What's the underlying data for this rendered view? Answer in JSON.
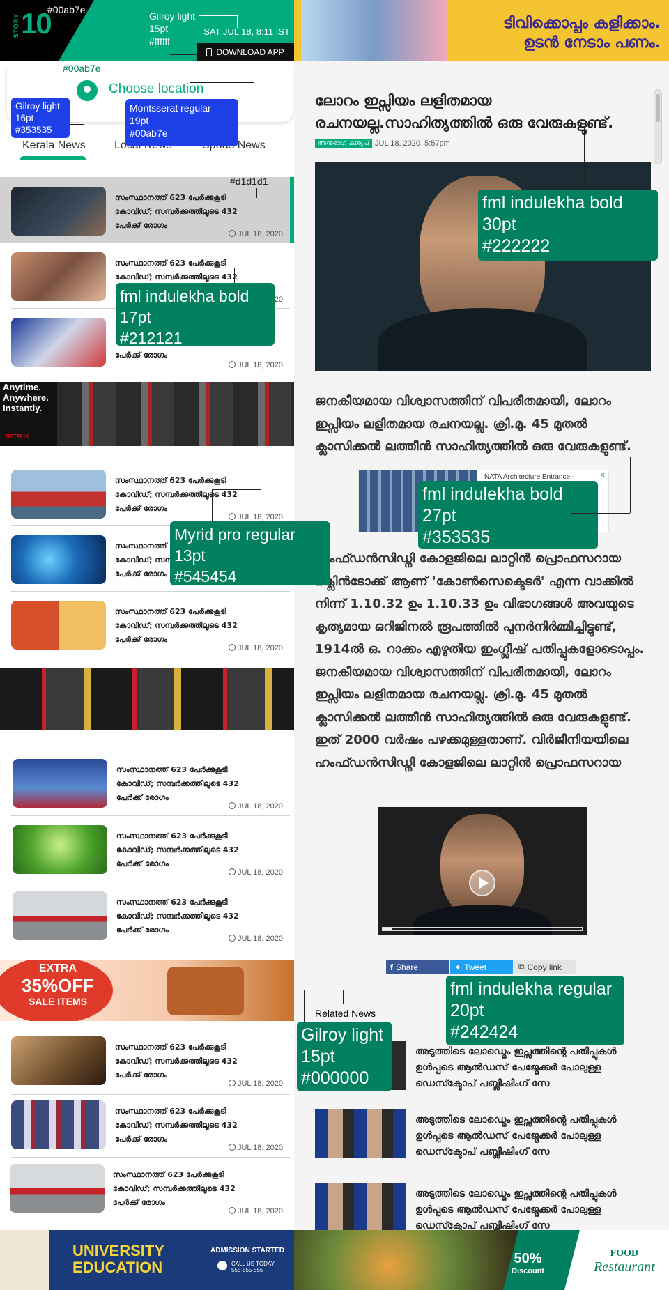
{
  "left": {
    "logo_side": "STORY",
    "logo_main": "10",
    "datetime": "SAT JUL 18, 8:11 IST",
    "download": "DOWNLOAD APP",
    "choose_location": "Choose location",
    "tabs": [
      "Kerala News",
      "Local News",
      "Sports News"
    ],
    "news": [
      {
        "title": "സംസ്ഥാനത്ത് 623 പേർക്കുകൂടി കോവിഡ്; സമ്പർക്കത്തിലൂടെ 432 പേർക്ക് രോഗം",
        "date": "JUL 18, 2020"
      },
      {
        "title": "സംസ്ഥാനത്ത് 623 പേർക്കുകൂടി കോവിഡ്; സമ്പർക്കത്തിലൂടെ 432 പേർക്ക് രോഗം",
        "date": "JUL 18, 2020"
      },
      {
        "title": "പേർക്ക് രോഗം",
        "date": "JUL 18, 2020"
      },
      {
        "title": "സംസ്ഥാനത്ത് 623 പേർക്കുകൂടി കോവിഡ്; സമ്പർക്കത്തിലൂടെ 432 പേർക്ക് രോഗം",
        "date": "JUL 18, 2020"
      },
      {
        "title": "സംസ്ഥാനത്ത് 623 പേർക്കുകൂടി കോവിഡ്; സമ്പർക്കത്തിലൂടെ 432 പേർക്ക് രോഗം",
        "date": "JUL 18, 2020"
      },
      {
        "title": "സംസ്ഥാനത്ത് 623 പേർക്കുകൂടി കോവിഡ്; സമ്പർക്കത്തിലൂടെ 432 പേർക്ക് രോഗം",
        "date": "JUL 18, 2020"
      },
      {
        "title": "സംസ്ഥാനത്ത് 623 പേർക്കുകൂടി കോവിഡ്; സമ്പർക്കത്തിലൂടെ 432 പേർക്ക് രോഗം",
        "date": "JUL 18, 2020"
      },
      {
        "title": "സംസ്ഥാനത്ത് 623 പേർക്കുകൂടി കോവിഡ്; സമ്പർക്കത്തിലൂടെ 432 പേർക്ക് രോഗം",
        "date": "JUL 18, 2020"
      },
      {
        "title": "സംസ്ഥാനത്ത് 623 പേർക്കുകൂടി കോവിഡ്; സമ്പർക്കത്തിലൂടെ 432 പേർക്ക് രോഗം",
        "date": "JUL 18, 2020"
      },
      {
        "title": "സംസ്ഥാനത്ത് 623 പേർക്കുകൂടി കോവിഡ്; സമ്പർക്കത്തിലൂടെ 432 പേർക്ക് രോഗം",
        "date": "JUL 18, 2020"
      },
      {
        "title": "സംസ്ഥാനത്ത് 623 പേർക്കുകൂടി കോവിഡ്; സമ്പർക്കത്തിലൂടെ 432 പേർക്ക് രോഗം",
        "date": "JUL 18, 2020"
      },
      {
        "title": "സംസ്ഥാനത്ത് 623 പേർക്കുകൂടി കോവിഡ്; സമ്പർക്കത്തിലൂടെ 432 പേർക്ക് രോഗം",
        "date": "JUL 18, 2020"
      }
    ],
    "ad_netflix": [
      "Anytime.",
      "Anywhere.",
      "Instantly.",
      "NETFLIX"
    ],
    "ad_sale": [
      "EXTRA",
      "35%OFF",
      "SALE ITEMS"
    ],
    "ad_university": [
      "UNIVERSITY",
      "EDUCATION",
      "ADMISSION STARTED",
      "CALL US TODAY",
      "555-555-555"
    ]
  },
  "right": {
    "banner": [
      "ടിവിക്കൊപ്പം കളിക്കാം.",
      "ഉടൻ നേടാം പണം."
    ],
    "title": "ലോറം ഇപ്സിയം ലളിതമായ രചനയല്ല.സാഹിത്യത്തിൽ ഒരു വേരുകളുണ്ട്.",
    "author": "അനുരാഗ് കശ്യപ്",
    "date": "JUL 18, 2020",
    "time": "5:57pm",
    "para1": "ജനകീയമായ വിശ്വാസത്തിന് വിപരീതമായി, ലോറം ഇപ്സിയം ലളിതമായ രചനയല്ല. ക്രി.മു. 45 മുതൽ ക്ലാസിക്കൽ ലത്തീൻ സാഹിത്യത്തിൽ ഒരു വേരുകളുണ്ട്.",
    "inline_ad": "NATA Architecture Entrance -",
    "para2": "ഹംഫ്ഡൻസിഡ്നി കോളജിലെ ലാറ്റിൻ പ്രൊഫസറായ മക്ലിൻടോക്ക് ആണ് 'കോൺസെക്ടെടർ' എന്ന വാക്കിൽ നിന്ന് 1.10.32 ഉം 1.10.33 ഉം വിഭാഗങ്ങൾ അവയുടെ കൃത്യമായ ഒറിജിനൽ രൂപത്തിൽ പുനർനിർമ്മിച്ചിട്ടുണ്ട്, 1914ൽ ഒ. റാക്കം എഴുതിയ ഇംഗ്ലീഷ് പതിപ്പുകളോടൊപ്പം. ജനകീയമായ വിശ്വാസത്തിന് വിപരീതമായി, ലോറം ഇപ്സിയം ലളിതമായ രചനയല്ല. ക്രി.മു. 45 മുതൽ ക്ലാസിക്കൽ ലത്തീൻ സാഹിത്യത്തിൽ ഒരു വേരുകളുണ്ട്. ഇത് 2000 വർഷം പഴക്കമുള്ളതാണ്. വിർജീനിയയിലെ ഹംഫ്ഡൻസിഡ്നി കോളജിലെ ലാറ്റിൻ പ്രൊഫസറായ",
    "share": [
      "Share",
      "Tweet",
      "Copy link"
    ],
    "related_heading": "Related News",
    "related": [
      "അടുത്തിടെ ലോഡ്മെം ഇപ്സത്തിന്റെ പതിപ്പുകൾ ഉൾപ്പടെ ആൽഡസ് പേജ്മേക്കർ പോലുള്ള ഡെസ്ക്ടോപ് പബ്ലിഷിംഗ് സേ",
      "അടുത്തിടെ ലോഡ്മെം ഇപ്സത്തിന്റെ പതിപ്പുകൾ ഉൾപ്പടെ ആൽഡസ് പേജ്മേക്കർ പോലുള്ള ഡെസ്ക്ടോപ് പബ്ലിഷിംഗ് സേ",
      "അടുത്തിടെ ലോഡ്മെം ഇപ്സത്തിന്റെ പതിപ്പുകൾ ഉൾപ്പടെ ആൽഡസ് പേജ്മേക്കർ പോലുള്ള ഡെസ്ക്ടോപ് പബ്ലിഷിംഗ് സേ"
    ],
    "ad_food": [
      "50%",
      "Discount",
      "FOOD",
      "Restaurant"
    ]
  },
  "annotations": {
    "a_00ab7e_top": "#00ab7e",
    "a_00ab7e_bottom": "#00ab7e",
    "a_gilroy_header": [
      "Gilroy light",
      "15pt",
      "#ffffff"
    ],
    "a_gilroy_tabs": [
      "Gilroy light",
      "16pt",
      "#353535"
    ],
    "a_montserrat": [
      "Montsserat regular",
      "19pt",
      "#00ab7e"
    ],
    "a_d1d1d1": "#d1d1d1",
    "a_fml17": [
      "fml indulekha bold",
      "17pt",
      "#212121"
    ],
    "a_myrid": [
      "Myrid pro regular",
      "13pt",
      "#545454"
    ],
    "a_fml30": [
      "fml indulekha bold",
      "30pt",
      "#222222"
    ],
    "a_fml27": [
      "fml indulekha bold",
      "27pt",
      "#353535"
    ],
    "a_fml20": [
      "fml indulekha regular",
      "20pt",
      "#242424"
    ],
    "a_gilroy15": [
      "Gilroy light",
      "15pt",
      "#000000"
    ]
  },
  "colors": {
    "accent": "#00ab7e",
    "divider": "#d1d1d1",
    "annotation": "#00805e",
    "annotation_blue": "#1d40e8"
  }
}
